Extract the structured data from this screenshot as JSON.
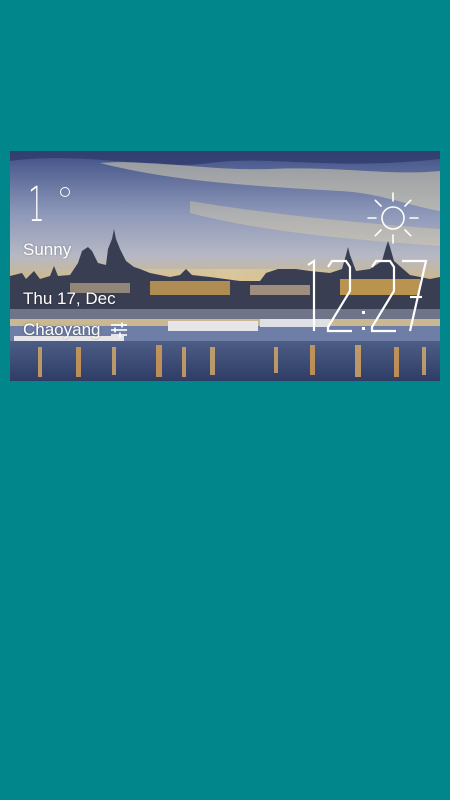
{
  "widget": {
    "temperature": "1",
    "temperature_unit": "°",
    "condition": "Sunny",
    "date": "Thu 17, Dec",
    "location": "Chaoyang",
    "time": "12:27",
    "icons": {
      "weather": "sun-icon",
      "settings": "sliders-settings-icon"
    }
  },
  "colors": {
    "background": "#00868b",
    "text": "#ffffff"
  }
}
